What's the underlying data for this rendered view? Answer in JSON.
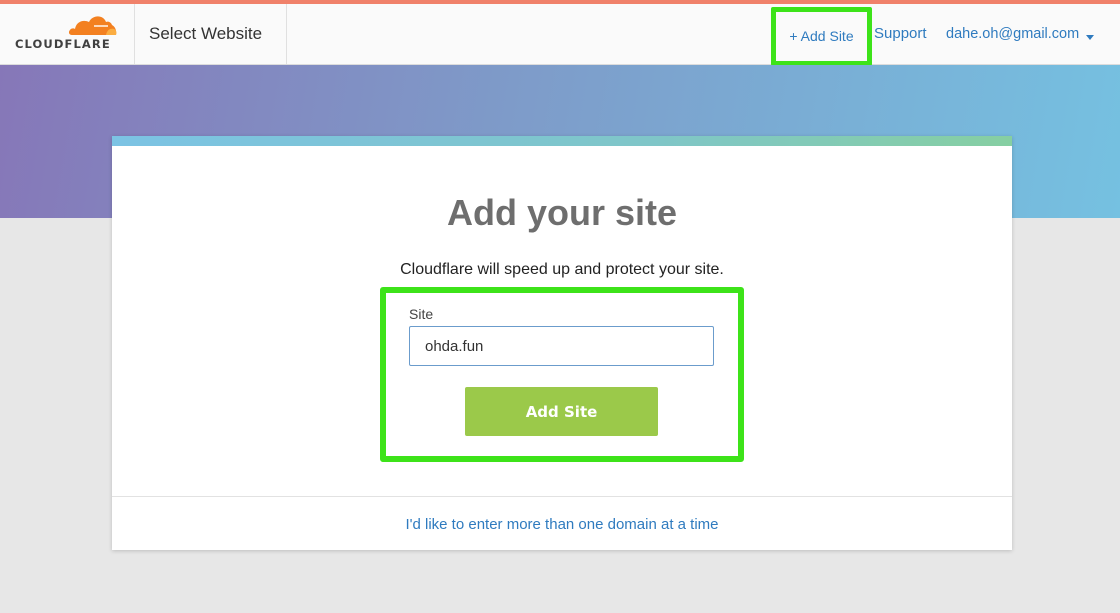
{
  "brand": {
    "name": "CLOUDFLARE",
    "cloud_color": "#f38020",
    "cloud_light_color": "#fbad41"
  },
  "header": {
    "page_title": "Select Website",
    "add_site_label": "+ Add Site",
    "support_label": "Support",
    "user_email": "dahe.oh@gmail.com",
    "user_menu_icon": "caret-down-icon"
  },
  "colors": {
    "link": "#2f7bbf",
    "primary_button": "#9bc94a",
    "highlight": "#3de319",
    "top_accent": "#f0816a"
  },
  "card": {
    "title": "Add your site",
    "subtitle": "Cloudflare will speed up and protect your site.",
    "form": {
      "site_label": "Site",
      "site_value": "ohda.fun",
      "submit_label": "Add Site"
    },
    "multi_domain_link": "I'd like to enter more than one domain at a time"
  }
}
